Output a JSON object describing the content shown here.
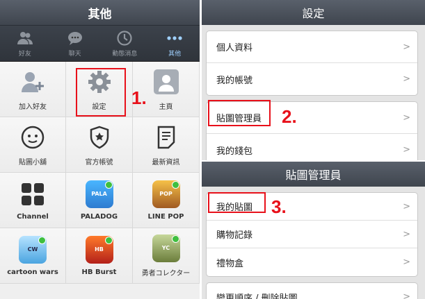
{
  "left": {
    "title": "其他",
    "tabs": [
      {
        "label": "好友",
        "icon": "friends-icon"
      },
      {
        "label": "聊天",
        "icon": "chat-icon"
      },
      {
        "label": "動態消息",
        "icon": "clock-icon"
      },
      {
        "label": "其他",
        "icon": "more-icon"
      }
    ],
    "grid": [
      {
        "label": "加入好友",
        "icon": "add-friend-icon"
      },
      {
        "label": "設定",
        "icon": "gear-icon"
      },
      {
        "label": "主頁",
        "icon": "profile-icon"
      },
      {
        "label": "貼圖小舖",
        "icon": "sticker-shop-icon"
      },
      {
        "label": "官方帳號",
        "icon": "official-account-icon"
      },
      {
        "label": "最新資訊",
        "icon": "news-icon"
      },
      {
        "label": "Channel",
        "icon": "channel-icon"
      },
      {
        "label": "PALADOG",
        "icon": "paladog-app-icon"
      },
      {
        "label": "LINE POP",
        "icon": "line-pop-app-icon"
      },
      {
        "label": "cartoon wars",
        "icon": "cartoon-wars-app-icon"
      },
      {
        "label": "HB Burst",
        "icon": "hb-burst-app-icon"
      },
      {
        "label": "勇者コレクター",
        "icon": "yusha-collector-app-icon"
      }
    ],
    "step1": "1."
  },
  "settings": {
    "title": "設定",
    "items": [
      "個人資料",
      "我的帳號",
      "貼圖管理員",
      "我的錢包"
    ],
    "step2": "2."
  },
  "sticker_manager": {
    "title": "貼圖管理員",
    "items": [
      "我的貼圖",
      "購物記錄",
      "禮物盒",
      "變更順序 / 刪除貼圖"
    ],
    "step3": "3."
  },
  "colors": {
    "highlight": "#e8101a",
    "header": "#4a5059",
    "active_tab": "#9fd0ff"
  }
}
